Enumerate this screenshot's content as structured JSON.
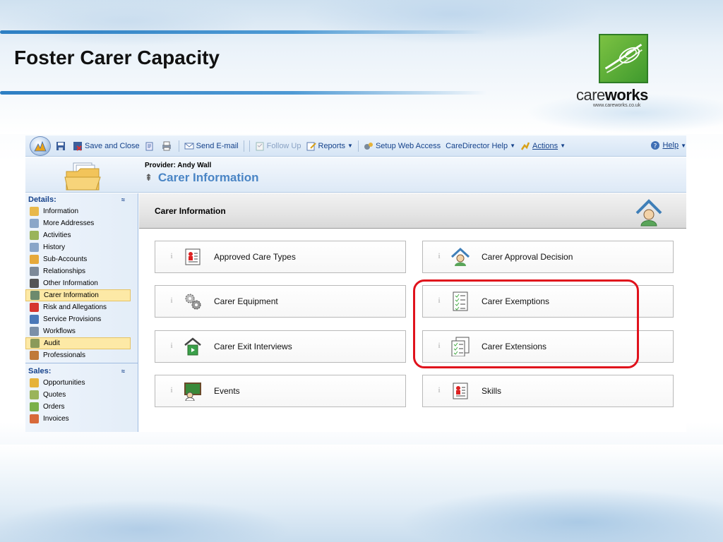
{
  "slide": {
    "title": "Foster Carer Capacity",
    "logo": {
      "word_light": "care",
      "word_bold": "works",
      "url": "www.careworks.co.uk"
    }
  },
  "toolbar": {
    "save_and_close": "Save and Close",
    "send_email": "Send E-mail",
    "follow_up": "Follow Up",
    "reports": "Reports",
    "setup_web_access": "Setup Web Access",
    "caredirector_help": "CareDirector Help",
    "actions": "Actions",
    "help": "Help"
  },
  "record": {
    "provider": "Provider: Andy Wall",
    "title": "Carer Information"
  },
  "nav": {
    "details_header": "Details:",
    "details_items": [
      {
        "label": "Information",
        "icon": "folder-icon",
        "color": "#e8b84a"
      },
      {
        "label": "More Addresses",
        "icon": "address-icon",
        "color": "#8aa6c8"
      },
      {
        "label": "Activities",
        "icon": "activities-icon",
        "color": "#9ab45a"
      },
      {
        "label": "History",
        "icon": "history-icon",
        "color": "#8aa6c8"
      },
      {
        "label": "Sub-Accounts",
        "icon": "sub-accounts-icon",
        "color": "#e6a93a"
      },
      {
        "label": "Relationships",
        "icon": "relationships-icon",
        "color": "#7d8a99"
      },
      {
        "label": "Other Information",
        "icon": "info-icon",
        "color": "#555555"
      },
      {
        "label": "Carer Information",
        "icon": "carer-icon",
        "color": "#6d8a6d"
      },
      {
        "label": "Risk and Allegations",
        "icon": "risk-icon",
        "color": "#d6342e"
      },
      {
        "label": "Service Provisions",
        "icon": "service-icon",
        "color": "#4a78b8"
      },
      {
        "label": "Workflows",
        "icon": "workflow-icon",
        "color": "#7a8fa8"
      },
      {
        "label": "Audit",
        "icon": "audit-icon",
        "color": "#8a9a5a"
      },
      {
        "label": "Professionals",
        "icon": "professionals-icon",
        "color": "#c07a3a"
      }
    ],
    "sales_header": "Sales:",
    "sales_items": [
      {
        "label": "Opportunities",
        "icon": "opportunities-icon",
        "color": "#e6b23a"
      },
      {
        "label": "Quotes",
        "icon": "quotes-icon",
        "color": "#9ab45a"
      },
      {
        "label": "Orders",
        "icon": "orders-icon",
        "color": "#7ab04a"
      },
      {
        "label": "Invoices",
        "icon": "invoices-icon",
        "color": "#d86a3a"
      }
    ]
  },
  "content": {
    "header": "Carer Information",
    "tiles": [
      {
        "label": "Approved Care Types",
        "icon": "approved-care-types-icon"
      },
      {
        "label": "Carer Approval Decision",
        "icon": "carer-approval-decision-icon"
      },
      {
        "label": "Carer Equipment",
        "icon": "carer-equipment-icon"
      },
      {
        "label": "Carer Exemptions",
        "icon": "carer-exemptions-icon"
      },
      {
        "label": "Carer Exit Interviews",
        "icon": "carer-exit-interviews-icon"
      },
      {
        "label": "Carer Extensions",
        "icon": "carer-extensions-icon"
      },
      {
        "label": "Events",
        "icon": "events-icon"
      },
      {
        "label": "Skills",
        "icon": "skills-icon"
      }
    ],
    "info_glyph": "i"
  },
  "colors": {
    "accent_blue": "#4a85c5",
    "highlight_red": "#e0121c",
    "brand_green": "#5aa936"
  }
}
